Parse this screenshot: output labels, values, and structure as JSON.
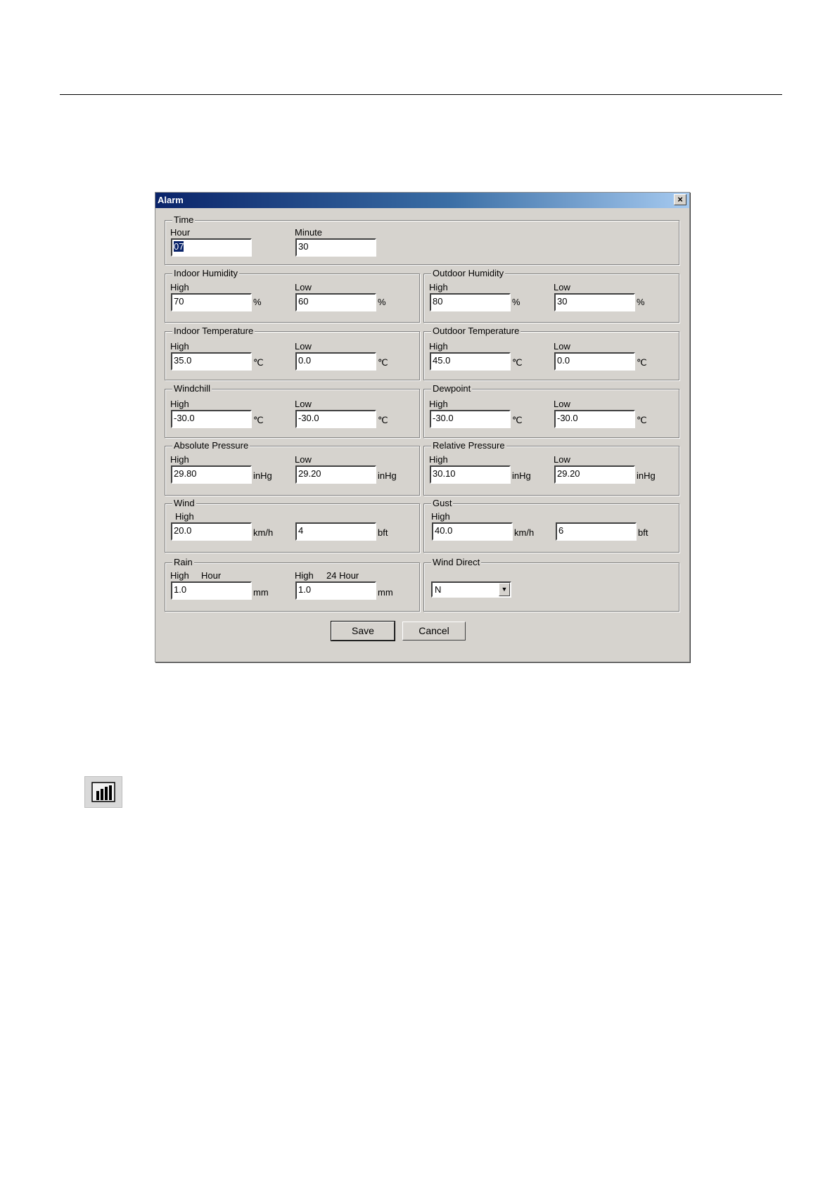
{
  "dialog": {
    "title": "Alarm",
    "close_symbol": "×"
  },
  "time": {
    "legend": "Time",
    "hour_label": "Hour",
    "hour": "07",
    "minute_label": "Minute",
    "minute": "30"
  },
  "indoor_humidity": {
    "legend": "Indoor Humidity",
    "high_label": "High",
    "high": "70",
    "low_label": "Low",
    "low": "60",
    "unit": "%"
  },
  "outdoor_humidity": {
    "legend": "Outdoor Humidity",
    "high_label": "High",
    "high": "80",
    "low_label": "Low",
    "low": "30",
    "unit": "%"
  },
  "indoor_temperature": {
    "legend": "Indoor Temperature",
    "high_label": "High",
    "high": "35.0",
    "low_label": "Low",
    "low": "0.0",
    "unit": "℃"
  },
  "outdoor_temperature": {
    "legend": "Outdoor Temperature",
    "high_label": "High",
    "high": "45.0",
    "low_label": "Low",
    "low": "0.0",
    "unit": "℃"
  },
  "windchill": {
    "legend": "Windchill",
    "high_label": "High",
    "high": "-30.0",
    "low_label": "Low",
    "low": "-30.0",
    "unit": "℃"
  },
  "dewpoint": {
    "legend": "Dewpoint",
    "high_label": "High",
    "high": "-30.0",
    "low_label": "Low",
    "low": "-30.0",
    "unit": "℃"
  },
  "absolute_pressure": {
    "legend": "Absolute Pressure",
    "high_label": "High",
    "high": "29.80",
    "low_label": "Low",
    "low": "29.20",
    "unit": "inHg"
  },
  "relative_pressure": {
    "legend": "Relative Pressure",
    "high_label": "High",
    "high": "30.10",
    "low_label": "Low",
    "low": "29.20",
    "unit": "inHg"
  },
  "wind": {
    "legend": "Wind",
    "high_label": "High",
    "speed": "20.0",
    "speed_unit": "km/h",
    "beaufort": "4",
    "beaufort_unit": "bft"
  },
  "gust": {
    "legend": "Gust",
    "high_label": "High",
    "speed": "40.0",
    "speed_unit": "km/h",
    "beaufort": "6",
    "beaufort_unit": "bft"
  },
  "rain": {
    "legend": "Rain",
    "hour_high_label": "High",
    "hour_label": "Hour",
    "hour": "1.0",
    "day_high_label": "High",
    "day_label": "24 Hour",
    "day": "1.0",
    "unit": "mm"
  },
  "wind_direct": {
    "legend": "Wind Direct",
    "value": "N",
    "arrow": "▼"
  },
  "buttons": {
    "save": "Save",
    "cancel": "Cancel"
  },
  "icons": {
    "history": "bar-chart-icon"
  }
}
